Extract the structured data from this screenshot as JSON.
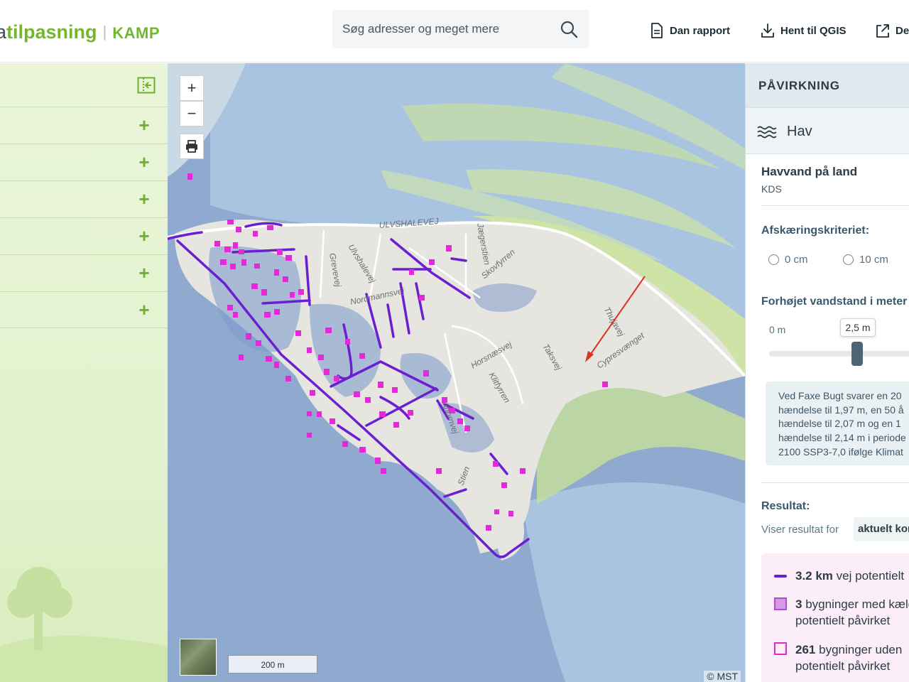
{
  "header": {
    "logo_prefix": "a",
    "logo_main": "tilpasning",
    "logo_sep": "|",
    "logo_product": "KAMP",
    "search_placeholder": "Søg adresser og meget mere",
    "btn_report": "Dan rapport",
    "btn_qgis": "Hent til QGIS",
    "btn_share": "Del"
  },
  "map": {
    "zoom_in": "+",
    "zoom_out": "−",
    "scale_label": "200 m",
    "attribution": "© MST",
    "street_labels": [
      "ULVSHALEVEJ",
      "Ulvshalevej",
      "Grevevej",
      "Skovfyrren",
      "Nordmannsvej",
      "Horsnæsvej",
      "Klitfyrren",
      "Taksvej",
      "Thujavej",
      "Cypresvænget",
      "Stien",
      "Jægerstien",
      "Ahornvej"
    ],
    "colors": {
      "water": "#8fa9cf",
      "land": "#e6e5e0",
      "roads_affected": "#6c1fd1",
      "buildings": "#e22bd7"
    }
  },
  "right_panel": {
    "section_title": "PÅVIRKNING",
    "category_label": "Hav",
    "layer_title": "Havvand på land",
    "layer_source": "KDS",
    "cutoff_title": "Afskæringskriteriet:",
    "radio_options": [
      "0 cm",
      "10 cm"
    ],
    "level_title": "Forhøjet vandstand i meter",
    "slider_min": "0 m",
    "slider_value_label": "2,5 m",
    "slider_value": 2.5,
    "info_lines": [
      "Ved Faxe Bugt svarer en 20",
      "hændelse til 1,97 m, en 50 å",
      "hændelse til 2,07 m og en 1",
      "hændelse til 2,14 m i periode",
      "2100 SSP3-7,0 ifølge Klimat"
    ],
    "result_title": "Resultat:",
    "result_viser": "Viser resultat for",
    "result_chip": "aktuelt kort",
    "legend": {
      "roads_value": "3.2 km",
      "roads_text": "vej potentielt",
      "b1_value": "3",
      "b1_text": "bygninger med kæld",
      "b1_text2": "potentielt påvirket",
      "b2_value": "261",
      "b2_text": "bygninger uden",
      "b2_text2": "potentielt påvirket"
    }
  }
}
